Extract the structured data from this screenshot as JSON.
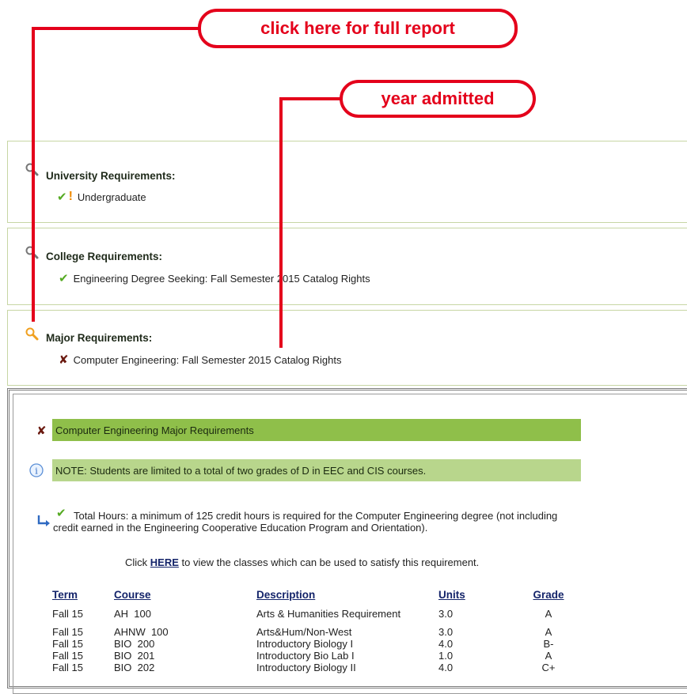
{
  "callouts": {
    "full_report": "click here for full report",
    "year_admitted": "year admitted"
  },
  "university": {
    "heading": "University Requirements:",
    "item": "Undergraduate"
  },
  "college": {
    "heading": "College Requirements:",
    "item": "Engineering Degree Seeking: Fall Semester 2015 Catalog Rights"
  },
  "major": {
    "heading": "Major Requirements:",
    "item": "Computer Engineering: Fall Semester 2015 Catalog Rights"
  },
  "detail": {
    "title": "Computer Engineering Major Requirements",
    "note": "NOTE: Students are limited to a total of two grades of D in EEC and CIS courses.",
    "total_hours": "Total Hours: a minimum of 125 credit hours is required for the Computer Engineering degree (not including credit earned in the Engineering Cooperative Education Program and Orientation).",
    "click_prefix": "Click",
    "click_link": "HERE",
    "click_suffix": "to view the classes which can be used to satisfy this requirement."
  },
  "table": {
    "headers": [
      "Term",
      "Course",
      "Description",
      "Units",
      "Grade"
    ],
    "rows": [
      [
        "Fall 15",
        "AH  100",
        "Arts & Humanities Requirement",
        "3.0",
        "A"
      ],
      [
        "Fall 15",
        "AHNW  100",
        "Arts&Hum/Non-West",
        "3.0",
        "A"
      ],
      [
        "Fall 15",
        "BIO  200",
        "Introductory Biology I",
        "4.0",
        "B-"
      ],
      [
        "Fall 15",
        "BIO  201",
        "Introductory Bio Lab I",
        "1.0",
        "A"
      ],
      [
        "Fall 15",
        "BIO  202",
        "Introductory Biology II",
        "4.0",
        "C+"
      ]
    ]
  },
  "colors": {
    "callout_red": "#e4001b",
    "bar_dark": "#8fbf4a",
    "bar_light": "#b8d68c",
    "check_green": "#55aa22",
    "x_mark": "#6b1a10"
  }
}
